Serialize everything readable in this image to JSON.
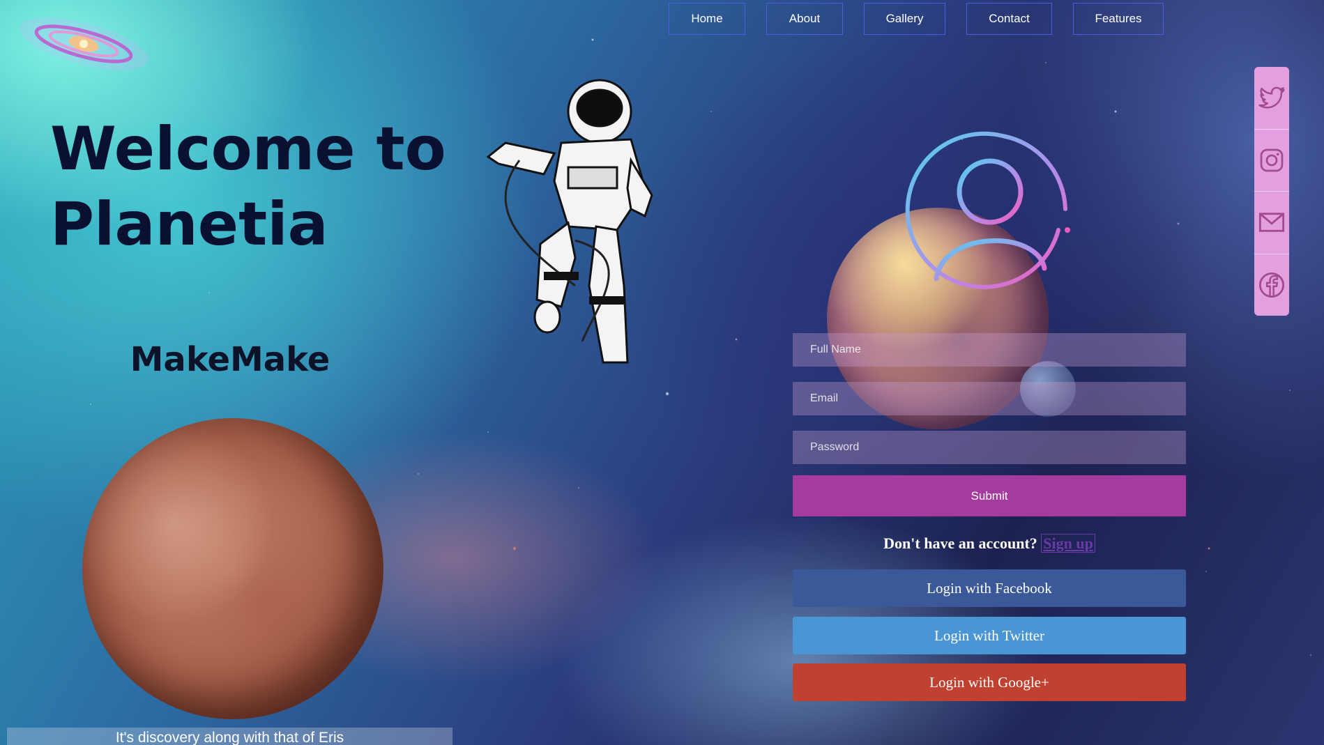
{
  "nav": {
    "items": [
      "Home",
      "About",
      "Gallery",
      "Contact",
      "Features"
    ]
  },
  "hero": {
    "title": "Welcome to Planetia",
    "planet_name": "MakeMake",
    "caption": "It's discovery along with that of Eris"
  },
  "form": {
    "full_name_placeholder": "Full Name",
    "email_placeholder": "Email",
    "password_placeholder": "Password",
    "submit_label": "Submit",
    "no_account_text": "Don't have an account?",
    "signup_link": "Sign up",
    "facebook_label": "Login with Facebook",
    "twitter_label": "Login with Twitter",
    "google_label": "Login with Google+"
  },
  "social_rail": {
    "icons": [
      "twitter-icon",
      "instagram-icon",
      "mail-icon",
      "facebook-icon"
    ]
  },
  "colors": {
    "submit": "#a63b9f",
    "facebook": "#3b5998",
    "twitter": "#4a96d4",
    "google": "#c0412f",
    "rail": "#e49fe1"
  }
}
